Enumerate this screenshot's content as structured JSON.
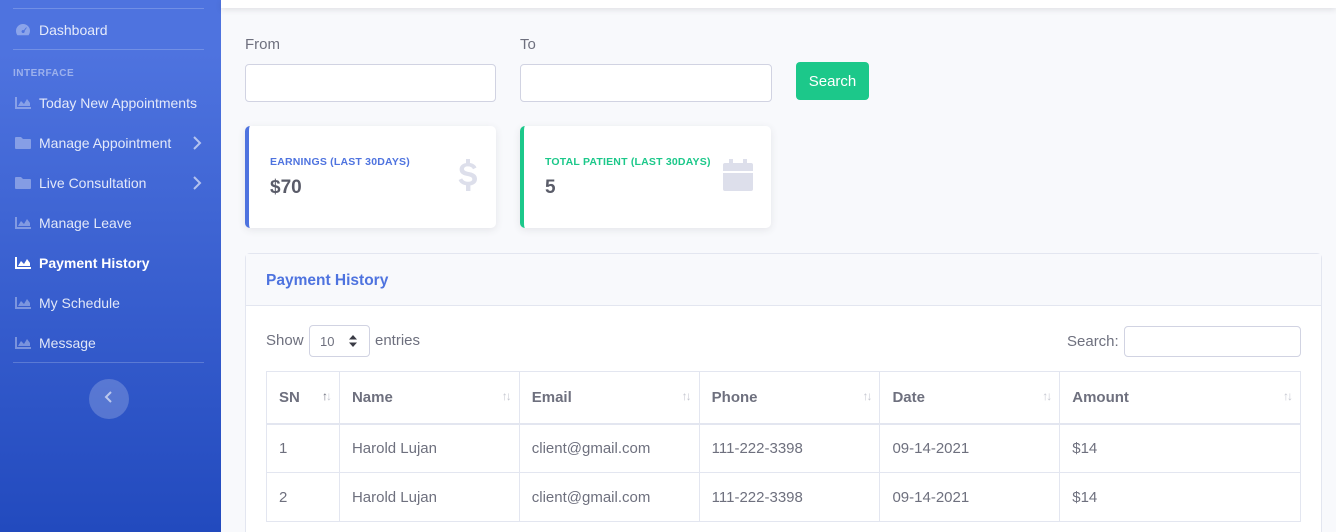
{
  "sidebar": {
    "top_item": "Dashboard",
    "heading": "INTERFACE",
    "items": [
      {
        "label": "Today New Appointments",
        "has_children": false,
        "active": false
      },
      {
        "label": "Manage Appointment",
        "has_children": true,
        "active": false
      },
      {
        "label": "Live Consultation",
        "has_children": true,
        "active": false
      },
      {
        "label": "Manage Leave",
        "has_children": false,
        "active": false
      },
      {
        "label": "Payment History",
        "has_children": false,
        "active": true
      },
      {
        "label": "My Schedule",
        "has_children": false,
        "active": false
      },
      {
        "label": "Message",
        "has_children": false,
        "active": false
      }
    ],
    "toggle_icon": "chevron-left-icon"
  },
  "filter": {
    "from_label": "From",
    "from_value": "",
    "to_label": "To",
    "to_value": "",
    "search_button": "Search"
  },
  "cards": [
    {
      "label": "EARNINGS (LAST 30DAYS)",
      "value": "$70",
      "icon": "dollar-icon",
      "color": "#4e73df"
    },
    {
      "label": "TOTAL PATIENT (LAST 30DAYS)",
      "value": "5",
      "icon": "calendar-icon",
      "color": "#1cc88a"
    }
  ],
  "panel": {
    "title": "Payment History",
    "show_label": "Show",
    "entries_value": "10",
    "entries_label": "entries",
    "search_label": "Search:",
    "search_value": "",
    "columns": [
      "SN",
      "Name",
      "Email",
      "Phone",
      "Date",
      "Amount"
    ],
    "rows": [
      [
        "1",
        "Harold Lujan",
        "client@gmail.com",
        "111-222-3398",
        "09-14-2021",
        "$14"
      ],
      [
        "2",
        "Harold Lujan",
        "client@gmail.com",
        "111-222-3398",
        "09-14-2021",
        "$14"
      ]
    ]
  },
  "colors": {
    "primary": "#4e73df",
    "success": "#1cc88a",
    "text": "#6e707e"
  }
}
